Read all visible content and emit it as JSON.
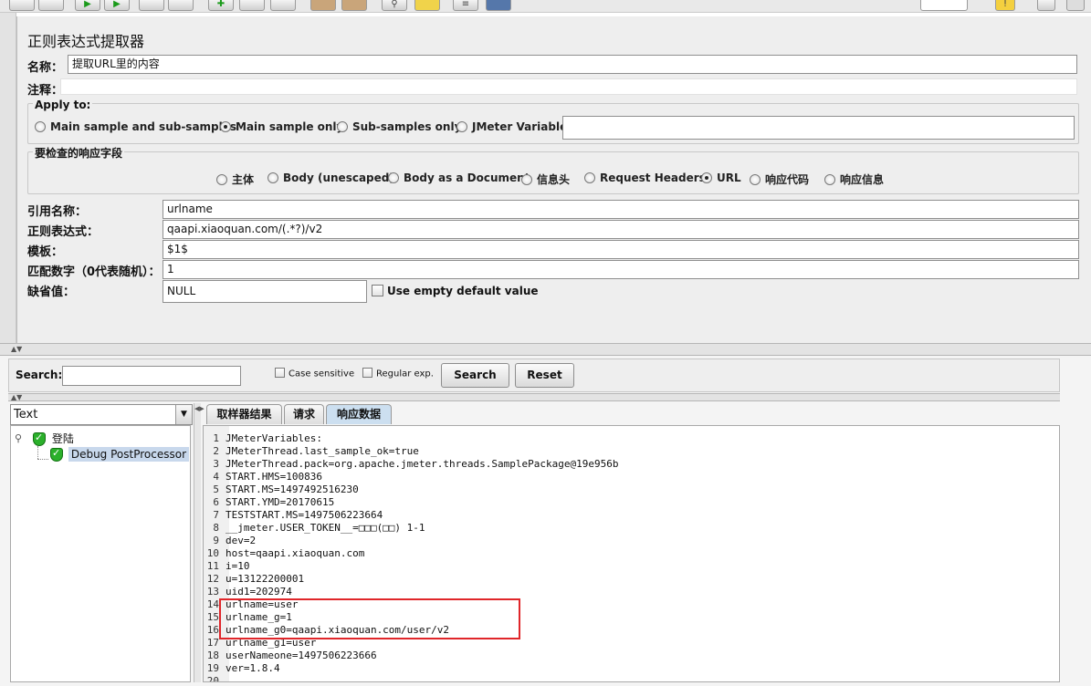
{
  "toolbar": {
    "icons": [
      "new-icon",
      "open-icon",
      "play-icon",
      "play-no-pause-icon",
      "stop-icon",
      "shutdown-icon",
      "remote-start-icon",
      "remote-stop-icon",
      "remote-shutdown-icon",
      "clear-icon",
      "clear-all-icon",
      "search-icon",
      "reset-search-icon",
      "function-helper-icon",
      "help-icon",
      "log-icon"
    ]
  },
  "extractor": {
    "title": "正则表达式提取器",
    "name_label": "名称：",
    "name_value": "提取URL里的内容",
    "comment_label": "注释：",
    "comment_value": "",
    "apply_to": {
      "legend": "Apply to:",
      "options": [
        "Main sample and sub-samples",
        "Main sample only",
        "Sub-samples only",
        "JMeter Variable"
      ],
      "selected": "Main sample only",
      "variable_value": ""
    },
    "field_to_check": {
      "legend": "要检查的响应字段",
      "options": [
        "主体",
        "Body (unescaped)",
        "Body as a Document",
        "信息头",
        "Request Headers",
        "URL",
        "响应代码",
        "响应信息"
      ],
      "selected": "URL"
    },
    "reference_name": {
      "label": "引用名称：",
      "value": "urlname"
    },
    "regex": {
      "label": "正则表达式：",
      "value": "qaapi.xiaoquan.com/(.*?)/v2"
    },
    "template": {
      "label": "模板：",
      "value": "$1$"
    },
    "match_no": {
      "label": "匹配数字（0代表随机）：",
      "value": "1"
    },
    "default_value": {
      "label": "缺省值：",
      "value": "NULL"
    },
    "use_empty_default": {
      "label": "Use empty default value",
      "checked": false
    }
  },
  "search": {
    "label": "Search:",
    "value": "",
    "case_sensitive": "Case sensitive",
    "regular_exp": "Regular exp.",
    "search_button": "Search",
    "reset_button": "Reset"
  },
  "tree": {
    "renderer": "Text",
    "root": "登陆",
    "child": "Debug PostProcessor"
  },
  "tabs": [
    "取样器结果",
    "请求",
    "响应数据"
  ],
  "active_tab": "响应数据",
  "response_lines": [
    "JMeterVariables:",
    "JMeterThread.last_sample_ok=true",
    "JMeterThread.pack=org.apache.jmeter.threads.SamplePackage@19e956b",
    "START.HMS=100836",
    "START.MS=1497492516230",
    "START.YMD=20170615",
    "TESTSTART.MS=1497506223664",
    "__jmeter.USER_TOKEN__=□□□(□□) 1-1",
    "dev=2",
    "host=qaapi.xiaoquan.com",
    "i=10",
    "u=13122200001",
    "uid1=202974",
    "urlname=user",
    "urlname_g=1",
    "urlname_g0=qaapi.xiaoquan.com/user/v2",
    "urlname_g1=user",
    "userNameone=1497506223666",
    "ver=1.8.4",
    ""
  ],
  "colors": {
    "highlight_box": "#e0262a",
    "active_tab": "#ccdff0",
    "selected_node": "#c8d8ec"
  }
}
